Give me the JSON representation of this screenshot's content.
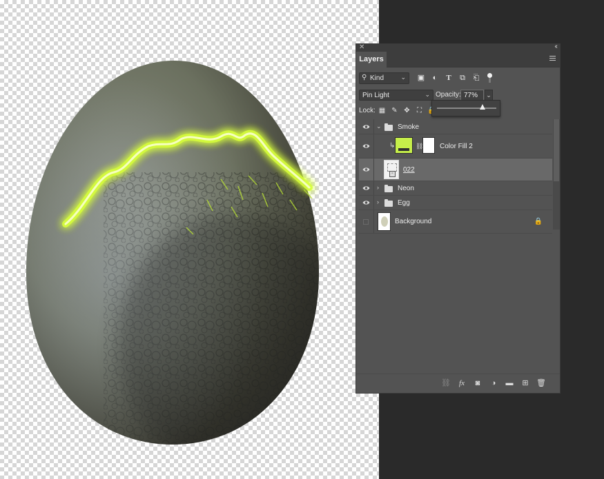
{
  "panel": {
    "tab_label": "Layers"
  },
  "filter": {
    "kind_label": "Kind",
    "icons": [
      "image-filter-icon",
      "adjustment-filter-icon",
      "type-filter-icon",
      "shape-filter-icon",
      "smart-object-filter-icon"
    ]
  },
  "blend": {
    "mode": "Pin Light",
    "opacity_label": "Opacity:",
    "opacity_value": "77%",
    "opacity_fraction": 0.77
  },
  "lock": {
    "label": "Lock:",
    "icons": [
      "lock-transparent-pixels-icon",
      "lock-image-pixels-icon",
      "lock-position-icon",
      "lock-artboard-icon",
      "lock-all-icon"
    ]
  },
  "layers": [
    {
      "name": "Smoke",
      "type": "group",
      "expanded": true,
      "visible": true
    },
    {
      "name": "Color Fill 2",
      "type": "fill",
      "clipped": true,
      "visible": true,
      "fill_color": "#c6ef4a"
    },
    {
      "name": "022",
      "type": "smart",
      "visible": true,
      "selected": true
    },
    {
      "name": "Neon",
      "type": "group",
      "expanded": false,
      "visible": true
    },
    {
      "name": "Egg",
      "type": "group",
      "expanded": false,
      "visible": true
    },
    {
      "name": "Background",
      "type": "background",
      "visible": false,
      "locked": true
    }
  ],
  "bottom_icons": [
    "link-layers-icon",
    "fx-icon",
    "add-mask-icon",
    "adjustment-layer-icon",
    "new-group-icon",
    "new-layer-icon",
    "trash-icon"
  ],
  "colors": {
    "neon": "#d8ff3a",
    "panel_bg": "#535353"
  }
}
